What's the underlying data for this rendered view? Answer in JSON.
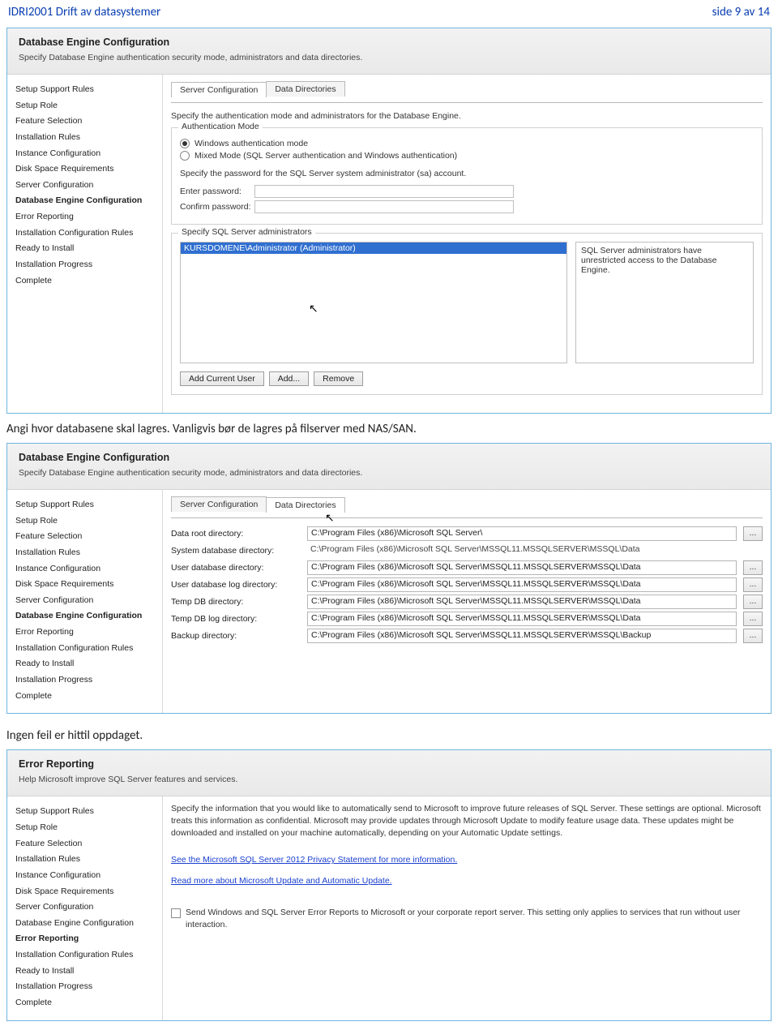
{
  "page": {
    "left": "IDRI2001 Drift av datasystemer",
    "right": "side 9 av 14"
  },
  "caption1": "Angi hvor databasene skal lagres. Vanligvis bør de lagres på filserver med NAS/SAN.",
  "caption2": "Ingen feil er hittil oppdaget.",
  "nav_items": [
    "Setup Support Rules",
    "Setup Role",
    "Feature Selection",
    "Installation Rules",
    "Instance Configuration",
    "Disk Space Requirements",
    "Server Configuration",
    "Database Engine Configuration",
    "Error Reporting",
    "Installation Configuration Rules",
    "Ready to Install",
    "Installation Progress",
    "Complete"
  ],
  "panel1": {
    "title": "Database Engine Configuration",
    "sub": "Specify Database Engine authentication security mode, administrators and data directories.",
    "active_nav": "Database Engine Configuration",
    "tabs": {
      "t0": "Server Configuration",
      "t1": "Data Directories",
      "active": 0
    },
    "intro": "Specify the authentication mode and administrators for the Database Engine.",
    "auth_legend": "Authentication Mode",
    "radio_win": "Windows authentication mode",
    "radio_mixed": "Mixed Mode (SQL Server authentication and Windows authentication)",
    "pwd_note": "Specify the password for the SQL Server system administrator (sa) account.",
    "lbl_enter": "Enter password:",
    "lbl_confirm": "Confirm password:",
    "admin_legend": "Specify SQL Server administrators",
    "admin_selected": "KURSDOMENE\\Administrator (Administrator)",
    "admin_note": "SQL Server administrators have unrestricted access to the Database Engine.",
    "btn_add_current": "Add Current User",
    "btn_add": "Add...",
    "btn_remove": "Remove"
  },
  "panel2": {
    "title": "Database Engine Configuration",
    "sub": "Specify Database Engine authentication security mode, administrators and data directories.",
    "active_nav": "Database Engine Configuration",
    "tabs": {
      "t0": "Server Configuration",
      "t1": "Data Directories",
      "active": 1
    },
    "rows": {
      "r0": {
        "label": "Data root directory:",
        "value": "C:\\Program Files (x86)\\Microsoft SQL Server\\",
        "browse": true,
        "readonly": false
      },
      "r1": {
        "label": "System database directory:",
        "value": "C:\\Program Files (x86)\\Microsoft SQL Server\\MSSQL11.MSSQLSERVER\\MSSQL\\Data",
        "browse": false,
        "readonly": true
      },
      "r2": {
        "label": "User database directory:",
        "value": "C:\\Program Files (x86)\\Microsoft SQL Server\\MSSQL11.MSSQLSERVER\\MSSQL\\Data",
        "browse": true,
        "readonly": false
      },
      "r3": {
        "label": "User database log directory:",
        "value": "C:\\Program Files (x86)\\Microsoft SQL Server\\MSSQL11.MSSQLSERVER\\MSSQL\\Data",
        "browse": true,
        "readonly": false
      },
      "r4": {
        "label": "Temp DB directory:",
        "value": "C:\\Program Files (x86)\\Microsoft SQL Server\\MSSQL11.MSSQLSERVER\\MSSQL\\Data",
        "browse": true,
        "readonly": false
      },
      "r5": {
        "label": "Temp DB log directory:",
        "value": "C:\\Program Files (x86)\\Microsoft SQL Server\\MSSQL11.MSSQLSERVER\\MSSQL\\Data",
        "browse": true,
        "readonly": false
      },
      "r6": {
        "label": "Backup directory:",
        "value": "C:\\Program Files (x86)\\Microsoft SQL Server\\MSSQL11.MSSQLSERVER\\MSSQL\\Backup",
        "browse": true,
        "readonly": false
      }
    },
    "browse_label": "..."
  },
  "panel3": {
    "title": "Error Reporting",
    "sub": "Help Microsoft improve SQL Server features and services.",
    "active_nav": "Error Reporting",
    "para": "Specify the information that you would like to automatically send to Microsoft to improve future releases of SQL Server. These settings are optional. Microsoft treats this information as confidential. Microsoft may provide updates through Microsoft Update to modify feature usage data. These updates might be downloaded and installed on your machine automatically, depending on your Automatic Update settings.",
    "link1": "See the Microsoft SQL Server 2012 Privacy Statement for more information.",
    "link2": "Read more about Microsoft Update and Automatic Update.",
    "chk_label": "Send Windows and SQL Server Error Reports to Microsoft or your corporate report server. This setting only applies to services that run without user interaction."
  }
}
